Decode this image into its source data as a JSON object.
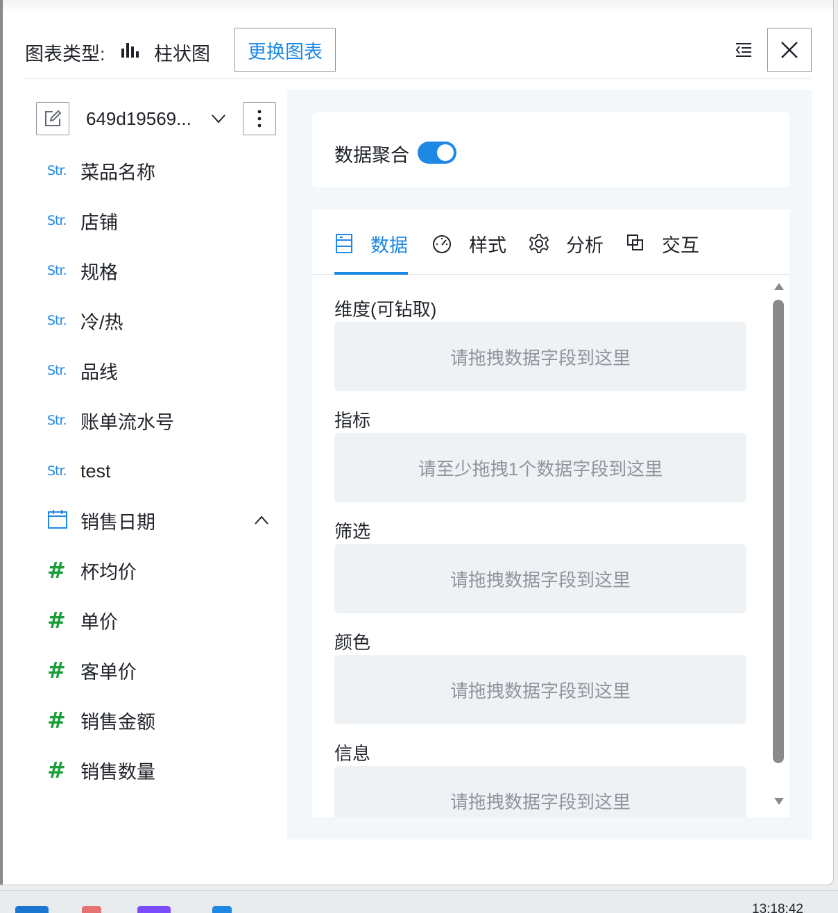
{
  "header": {
    "chart_type_label": "图表类型:",
    "chart_type_value": "柱状图",
    "switch_button": "更换图表"
  },
  "dataset": {
    "name": "649d19569..."
  },
  "fields": [
    {
      "type": "Str.",
      "name": "菜品名称"
    },
    {
      "type": "Str.",
      "name": "店铺"
    },
    {
      "type": "Str.",
      "name": "规格"
    },
    {
      "type": "Str.",
      "name": "冷/热"
    },
    {
      "type": "Str.",
      "name": "品线"
    },
    {
      "type": "Str.",
      "name": "账单流水号"
    },
    {
      "type": "Str.",
      "name": "test"
    },
    {
      "type": "date",
      "name": "销售日期"
    },
    {
      "type": "#",
      "name": "杯均价"
    },
    {
      "type": "#",
      "name": "单价"
    },
    {
      "type": "#",
      "name": "客单价"
    },
    {
      "type": "#",
      "name": "销售金额"
    },
    {
      "type": "#",
      "name": "销售数量"
    }
  ],
  "aggregation": {
    "label": "数据聚合",
    "enabled": true
  },
  "tabs": [
    {
      "label": "数据",
      "icon": "data-icon",
      "active": true
    },
    {
      "label": "样式",
      "icon": "gauge-icon",
      "active": false
    },
    {
      "label": "分析",
      "icon": "gear-icon",
      "active": false
    },
    {
      "label": "交互",
      "icon": "interaction-icon",
      "active": false
    }
  ],
  "sections": [
    {
      "title": "维度(可钻取)",
      "placeholder": "请拖拽数据字段到这里"
    },
    {
      "title": "指标",
      "placeholder": "请至少拖拽1个数据字段到这里"
    },
    {
      "title": "筛选",
      "placeholder": "请拖拽数据字段到这里"
    },
    {
      "title": "颜色",
      "placeholder": "请拖拽数据字段到这里"
    },
    {
      "title": "信息",
      "placeholder": "请拖拽数据字段到这里"
    }
  ],
  "taskbar": {
    "clock": "13:18:42"
  },
  "colors": {
    "accent": "#1e88e5",
    "measure": "#1a9e3a",
    "dropzone": "#eff2f5"
  }
}
